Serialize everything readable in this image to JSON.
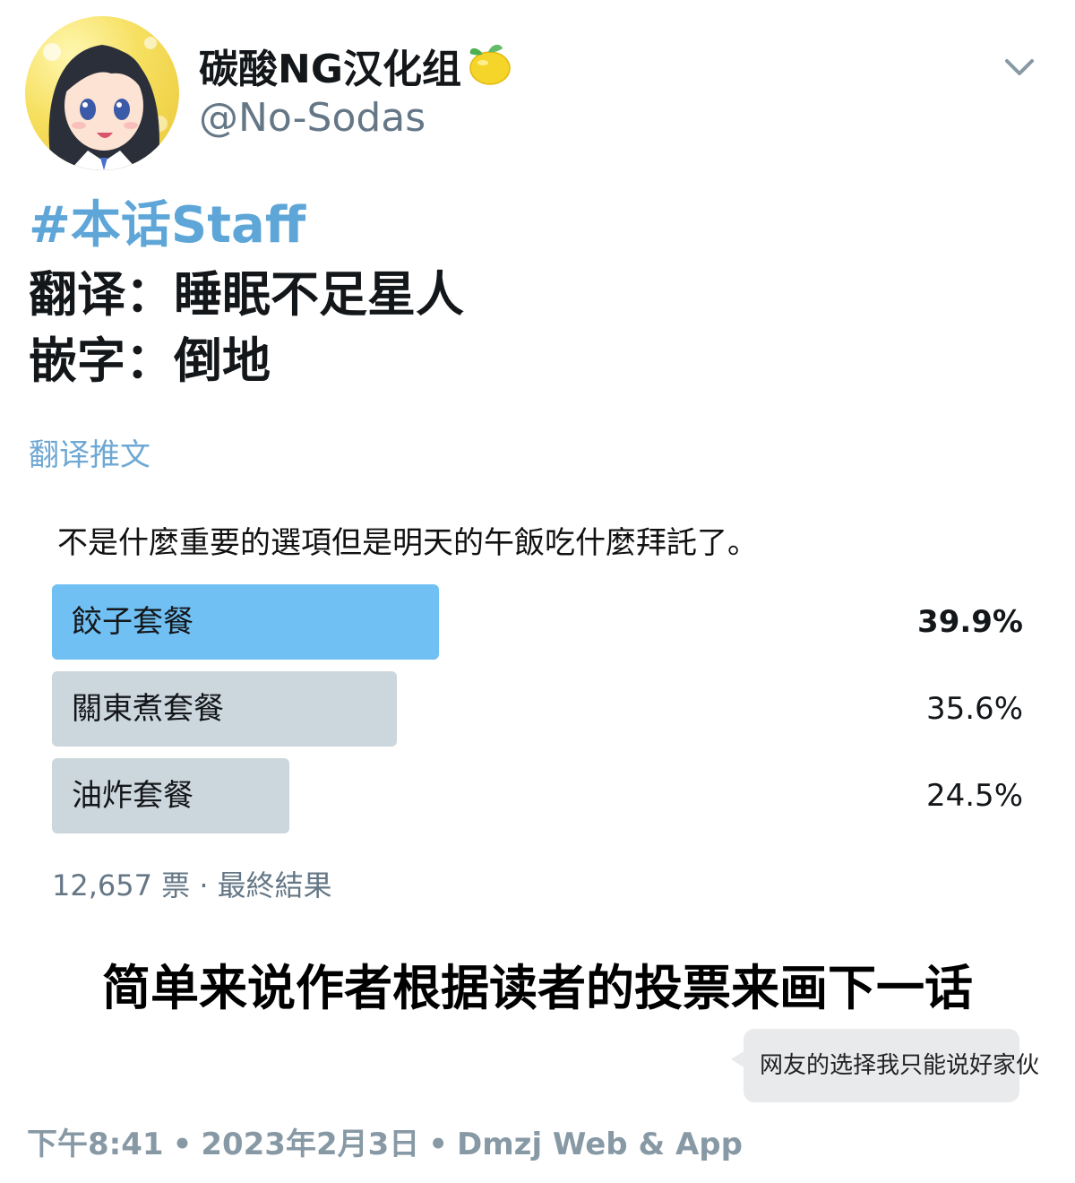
{
  "tweet": {
    "author": {
      "display_name": "碳酸NG汉化组",
      "handle": "@No-Sodas",
      "avatar_icon": "anime-girl-avatar",
      "badge_icon": "lemon-icon"
    },
    "hashtag": "#本话Staff",
    "staff": [
      "翻译：睡眠不足星人",
      "嵌字：倒地"
    ],
    "translate_label": "翻译推文",
    "poll": {
      "question": "不是什麼重要的選項但是明天的午飯吃什麼拜託了。",
      "options": [
        {
          "label": "餃子套餐",
          "percent_text": "39.9%",
          "percent": 39.9,
          "winner": true
        },
        {
          "label": "關東煮套餐",
          "percent_text": "35.6%",
          "percent": 35.6,
          "winner": false
        },
        {
          "label": "油炸套餐",
          "percent_text": "24.5%",
          "percent": 24.5,
          "winner": false
        }
      ],
      "footer": "12,657 票 · 最終結果"
    },
    "caption": "简单来说作者根据读者的投票来画下一话",
    "comment": "网友的选择我只能说好家伙",
    "timestamp": {
      "time": "下午8:41",
      "date": "2023年2月3日",
      "source": "Dmzj Web & App"
    }
  },
  "colors": {
    "link": "#5ea6d8",
    "winner_bar": "#71c0f3",
    "other_bar": "#ccd6dd",
    "muted": "#657786"
  }
}
